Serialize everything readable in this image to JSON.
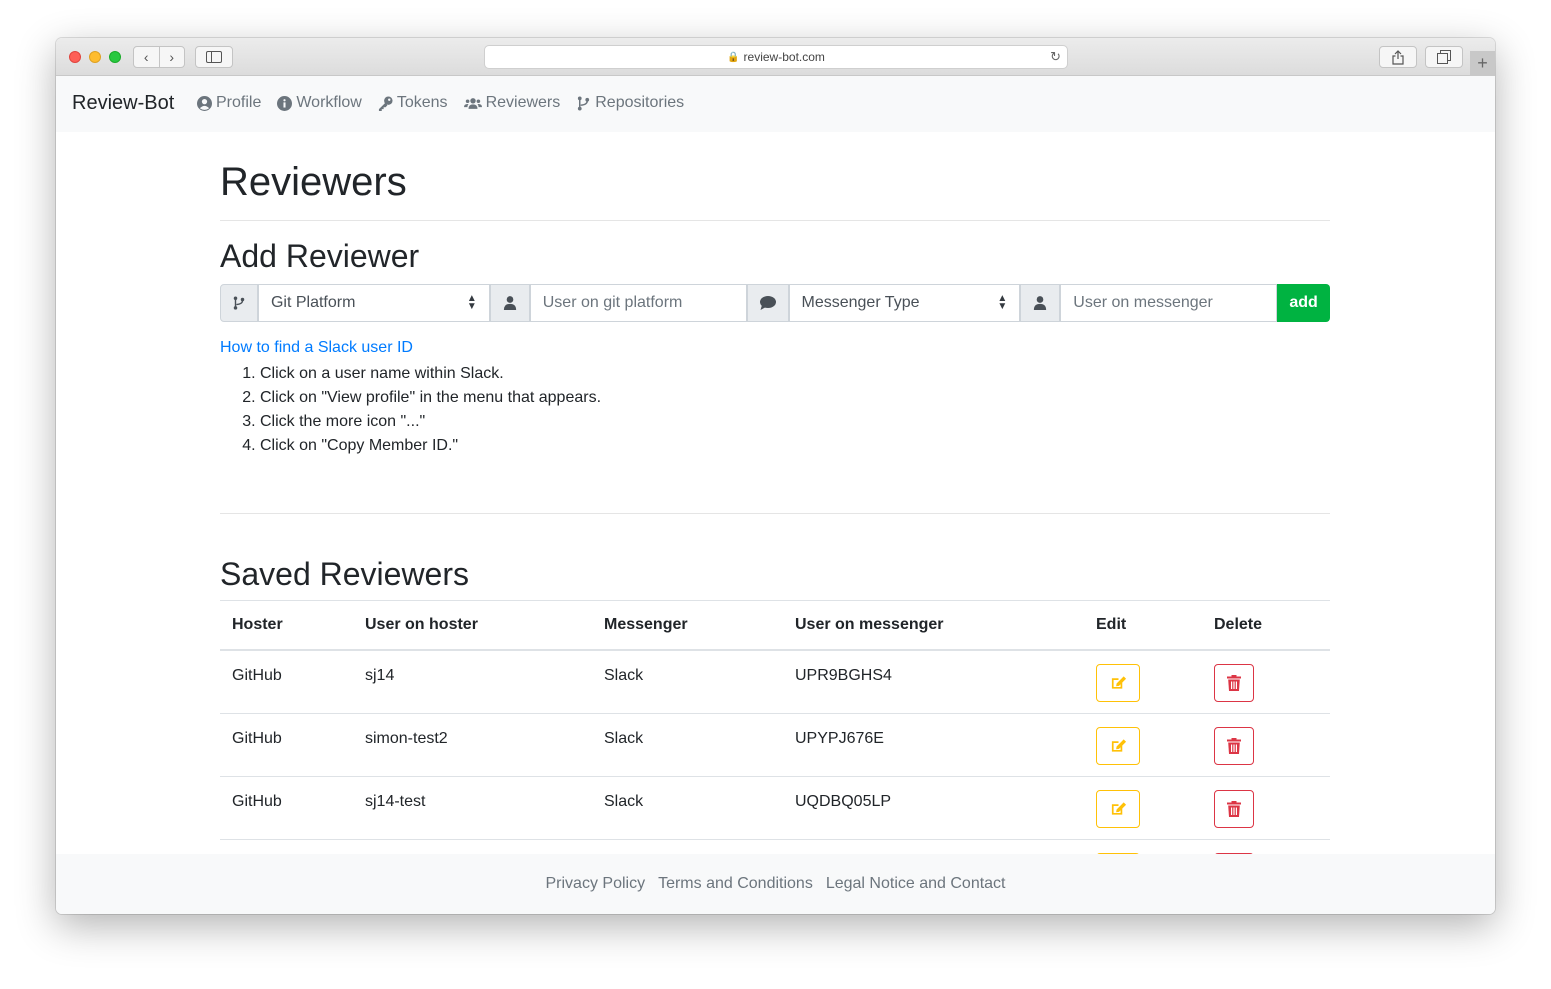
{
  "browser": {
    "url": "review-bot.com",
    "new_tab": "+"
  },
  "navbar": {
    "brand": "Review-Bot",
    "links": [
      {
        "label": "Profile",
        "icon": "user-circle-icon"
      },
      {
        "label": "Workflow",
        "icon": "info-circle-icon"
      },
      {
        "label": "Tokens",
        "icon": "key-icon"
      },
      {
        "label": "Reviewers",
        "icon": "users-icon"
      },
      {
        "label": "Repositories",
        "icon": "code-branch-icon"
      }
    ]
  },
  "page": {
    "title": "Reviewers",
    "add_section": {
      "title": "Add Reviewer",
      "git_platform_select": "Git Platform",
      "git_user_placeholder": "User on git platform",
      "messenger_type_select": "Messenger Type",
      "messenger_user_placeholder": "User on messenger",
      "add_button": "add"
    },
    "help": {
      "link": "How to find a Slack user ID",
      "steps": [
        "Click on a user name within Slack.",
        "Click on \"View profile\" in the menu that appears.",
        "Click the more icon \"...\"",
        "Click on \"Copy Member ID.\""
      ]
    },
    "saved_section": {
      "title": "Saved Reviewers",
      "columns": [
        "Hoster",
        "User on hoster",
        "Messenger",
        "User on messenger",
        "Edit",
        "Delete"
      ],
      "rows": [
        {
          "hoster": "GitHub",
          "user": "sj14",
          "messenger": "Slack",
          "messenger_user": "UPR9BGHS4"
        },
        {
          "hoster": "GitHub",
          "user": "simon-test2",
          "messenger": "Slack",
          "messenger_user": "UPYPJ676E"
        },
        {
          "hoster": "GitHub",
          "user": "sj14-test",
          "messenger": "Slack",
          "messenger_user": "UQDBQ05LP"
        }
      ]
    }
  },
  "footer": {
    "links": [
      "Privacy Policy",
      "Terms and Conditions",
      "Legal Notice and Contact"
    ]
  },
  "colors": {
    "add_button": "#00b341",
    "link": "#007bff",
    "edit": "#ffc107",
    "delete": "#dc3545"
  }
}
